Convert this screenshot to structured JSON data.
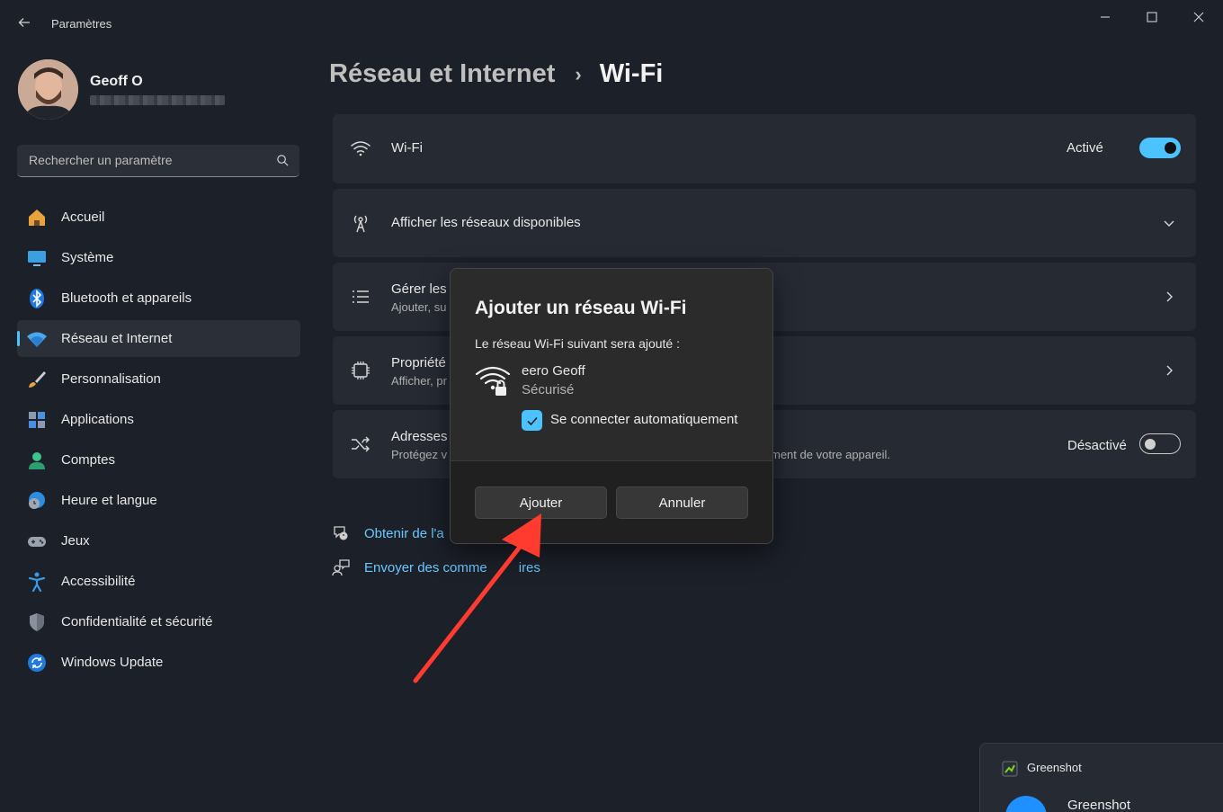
{
  "window": {
    "app_title": "Paramètres"
  },
  "profile": {
    "name": "Geoff O"
  },
  "search": {
    "placeholder": "Rechercher un paramètre"
  },
  "nav": {
    "items": [
      {
        "label": "Accueil",
        "icon": "home-icon"
      },
      {
        "label": "Système",
        "icon": "monitor-icon"
      },
      {
        "label": "Bluetooth et appareils",
        "icon": "bluetooth-icon"
      },
      {
        "label": "Réseau et Internet",
        "icon": "wifi-icon",
        "active": true
      },
      {
        "label": "Personnalisation",
        "icon": "brush-icon"
      },
      {
        "label": "Applications",
        "icon": "apps-icon"
      },
      {
        "label": "Comptes",
        "icon": "person-icon"
      },
      {
        "label": "Heure et langue",
        "icon": "globe-clock-icon"
      },
      {
        "label": "Jeux",
        "icon": "gamepad-icon"
      },
      {
        "label": "Accessibilité",
        "icon": "accessibility-icon"
      },
      {
        "label": "Confidentialité et sécurité",
        "icon": "shield-icon"
      },
      {
        "label": "Windows Update",
        "icon": "update-icon"
      }
    ],
    "accent": "#4cc2ff"
  },
  "header": {
    "parent": "Réseau et Internet",
    "separator": "›",
    "current": "Wi-Fi"
  },
  "cards": {
    "wifi": {
      "title": "Wi-Fi",
      "state": "Activé",
      "toggle_on": true
    },
    "available": {
      "title": "Afficher les réseaux disponibles"
    },
    "manage": {
      "title": "Gérer les",
      "sub": "Ajouter, su"
    },
    "props": {
      "title": "Propriété",
      "sub": "Afficher, pr"
    },
    "random": {
      "title": "Adresses",
      "sub": "Protégez v",
      "sub_right": "ment de votre appareil.",
      "state": "Désactivé",
      "toggle_on": false
    }
  },
  "links": {
    "help": "Obtenir de l'a",
    "feedback": "Envoyer des comme",
    "feedback_tail": "ires"
  },
  "dialog": {
    "title": "Ajouter un réseau Wi-Fi",
    "description": "Le réseau Wi-Fi suivant sera ajouté :",
    "network_name": "eero Geoff",
    "network_security": "Sécurisé",
    "auto_connect_label": "Se connecter automatiquement",
    "auto_connect_checked": true,
    "add_label": "Ajouter",
    "cancel_label": "Annuler"
  },
  "notification": {
    "app": "Greenshot",
    "title": "Greenshot"
  },
  "annotation": {
    "arrow_color": "#ff3b2f"
  }
}
